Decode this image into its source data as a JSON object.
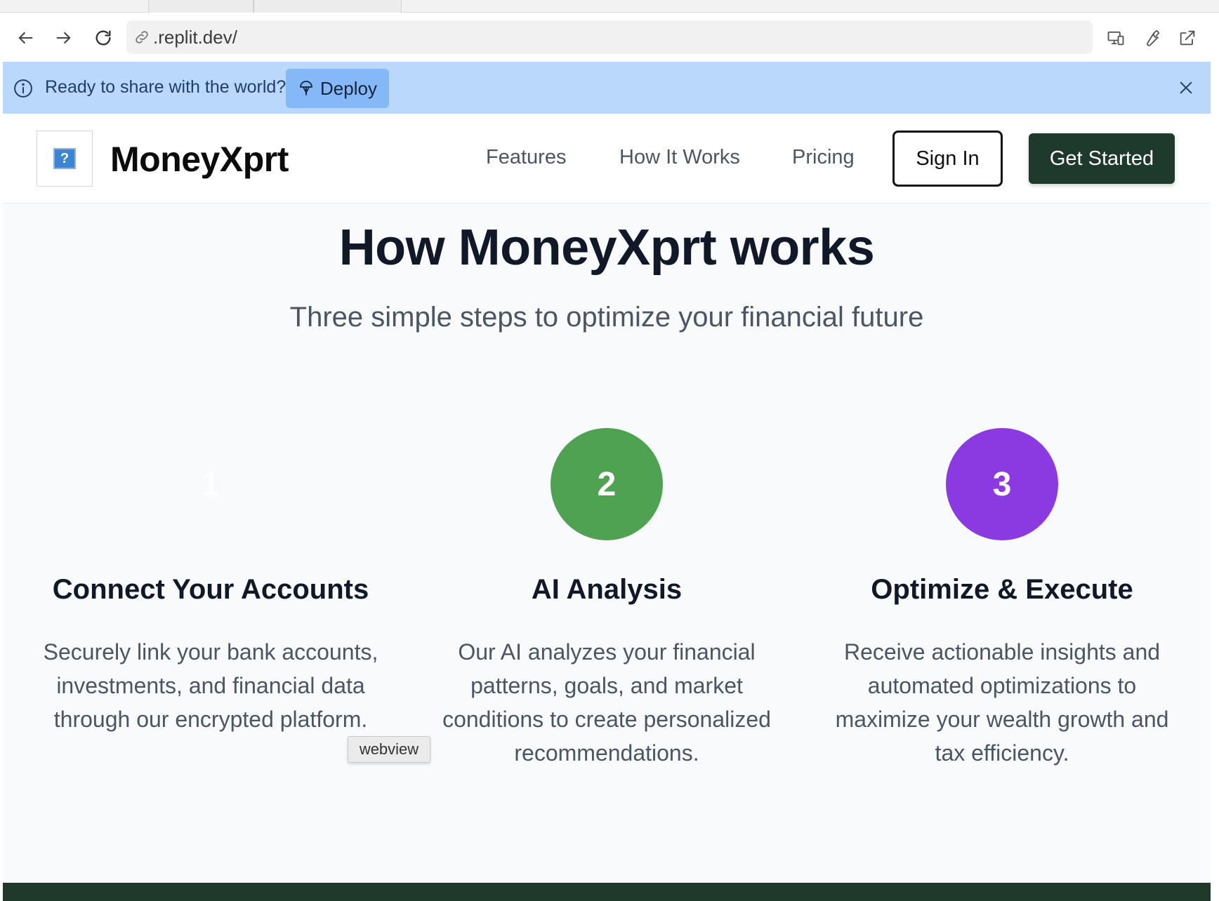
{
  "browser": {
    "address": ".replit.dev/"
  },
  "banner": {
    "message": "Ready to share with the world?",
    "deploy_label": "Deploy"
  },
  "header": {
    "brand": "MoneyXprt",
    "nav": [
      "Features",
      "How It Works",
      "Pricing"
    ],
    "signin_label": "Sign In",
    "get_started_label": "Get Started"
  },
  "main": {
    "title": "How MoneyXprt works",
    "subtitle": "Three simple steps to optimize your financial future",
    "steps": [
      {
        "number": "1",
        "title": "Connect Your Accounts",
        "description": "Securely link your bank accounts, investments, and financial data through our encrypted platform.",
        "color": "#f8fafc"
      },
      {
        "number": "2",
        "title": "AI Analysis",
        "description": "Our AI analyzes your financial patterns, goals, and market conditions to create personalized recommendations.",
        "color": "#4ea252"
      },
      {
        "number": "3",
        "title": "Optimize & Execute",
        "description": "Receive actionable insights and automated optimizations to maximize your wealth growth and tax efficiency.",
        "color": "#8b3ae2"
      }
    ]
  },
  "tooltip": "webview",
  "colors": {
    "banner_bg": "#b9d8fb",
    "deploy_bg": "#85b8f6",
    "primary_dark": "#1d3a2c",
    "page_bg": "#f8fafc"
  }
}
